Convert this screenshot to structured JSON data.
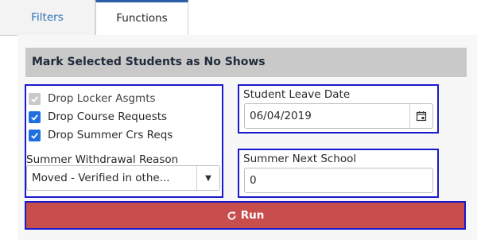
{
  "tabs": [
    {
      "label": "Filters"
    },
    {
      "label": "Functions"
    }
  ],
  "section": {
    "title": "Mark Selected Students as No Shows"
  },
  "options": {
    "drop_locker": {
      "label": "Drop Locker Asgmts",
      "checked": true,
      "disabled": true
    },
    "drop_course": {
      "label": "Drop Course Requests",
      "checked": true
    },
    "drop_summer": {
      "label": "Drop Summer Crs Reqs",
      "checked": true
    }
  },
  "withdrawal": {
    "label": "Summer Withdrawal Reason",
    "value": "Moved - Verified in othe..."
  },
  "leave_date": {
    "label": "Student Leave Date",
    "value": "06/04/2019"
  },
  "next_school": {
    "label": "Summer Next School",
    "value": "0"
  },
  "run_button": {
    "label": "Run"
  },
  "colors": {
    "tab_accent": "#2a5fa5",
    "checkbox": "#1f6fe0",
    "run": "#c84d4d",
    "highlight_border": "#1a1acc"
  },
  "icons": {
    "calendar": "calendar-icon",
    "refresh": "refresh-icon",
    "caret": "chevron-down-icon"
  }
}
